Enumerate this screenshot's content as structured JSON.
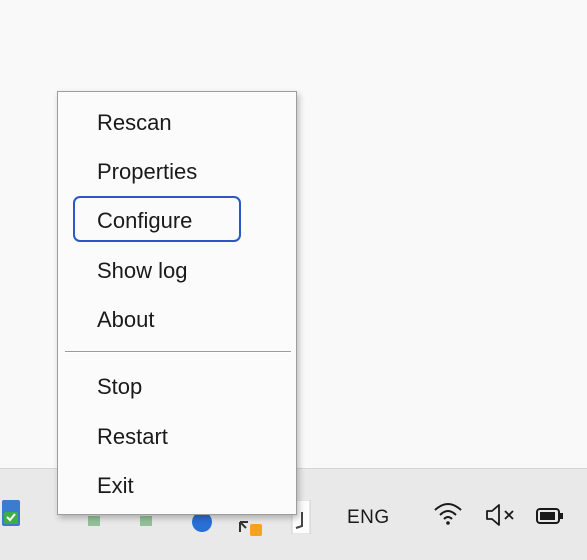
{
  "context_menu": {
    "items": [
      {
        "label": "Rescan"
      },
      {
        "label": "Properties"
      },
      {
        "label": "Configure",
        "focused": true
      },
      {
        "label": "Show log"
      },
      {
        "label": "About"
      },
      {
        "label": "Stop"
      },
      {
        "label": "Restart"
      },
      {
        "label": "Exit"
      }
    ],
    "focus_color": "#2b57c8"
  },
  "taskbar": {
    "language": "ENG",
    "icons": [
      "shield-icon",
      "app-icon",
      "app-icon",
      "browser-icon",
      "app-icon",
      "app-icon",
      "wifi-icon",
      "volume-muted-icon",
      "battery-icon"
    ]
  }
}
